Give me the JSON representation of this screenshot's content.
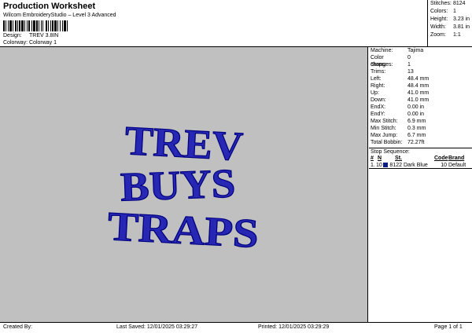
{
  "header": {
    "title": "Production Worksheet",
    "subtitle": "Wilcom EmbroideryStudio – Level 3 Advanced",
    "design_label": "Design:",
    "design_value": "TREV 3.8IN",
    "colorway_label": "Colorway:",
    "colorway_value": "Colorway 1"
  },
  "top_stats": [
    {
      "label": "Stitches:",
      "value": "8124"
    },
    {
      "label": "Colors:",
      "value": "1"
    },
    {
      "label": "Height:",
      "value": "3.23 in"
    },
    {
      "label": "Width:",
      "value": "3.81 in"
    },
    {
      "label": "Zoom:",
      "value": "1:1"
    }
  ],
  "design": {
    "lines": [
      "TREV",
      "BUYS",
      "TRAPS"
    ],
    "thread_color": "#2d2db8",
    "background": "#c0c0c0"
  },
  "info": [
    {
      "label": "Machine:",
      "value": "Tajima"
    },
    {
      "label": "Color changes:",
      "value": "0"
    },
    {
      "label": "Stops:",
      "value": "1"
    },
    {
      "label": "Trims:",
      "value": "13"
    },
    {
      "label": "Left:",
      "value": "48.4 mm"
    },
    {
      "label": "Right:",
      "value": "48.4 mm"
    },
    {
      "label": "Up:",
      "value": "41.0 mm"
    },
    {
      "label": "Down:",
      "value": "41.0 mm"
    },
    {
      "label": "EndX:",
      "value": "0.00 in"
    },
    {
      "label": "EndY:",
      "value": "0.00 in"
    },
    {
      "label": "Max Stitch:",
      "value": "6.9 mm"
    },
    {
      "label": "Min Stitch:",
      "value": "0.3 mm"
    },
    {
      "label": "Max Jump:",
      "value": "6.7 mm"
    },
    {
      "label": "Total Bobbin:",
      "value": "72.27ft"
    }
  ],
  "stop_sequence": {
    "title": "Stop Sequence:",
    "headers": {
      "num": "#",
      "n": "N",
      "st": "St.",
      "code": "Code",
      "brand": "Brand"
    },
    "rows": [
      {
        "num": "1.",
        "n": "10",
        "swatch": "#0b1d8a",
        "st": "8122",
        "color": "Dark Blue",
        "code": "10",
        "brand": "Default"
      }
    ]
  },
  "footer": {
    "created_by": "Created By:",
    "last_saved": "Last Saved: 12/01/2025 03:29:27",
    "printed": "Printed: 12/01/2025 03:29:29",
    "page": "Page 1 of 1"
  }
}
